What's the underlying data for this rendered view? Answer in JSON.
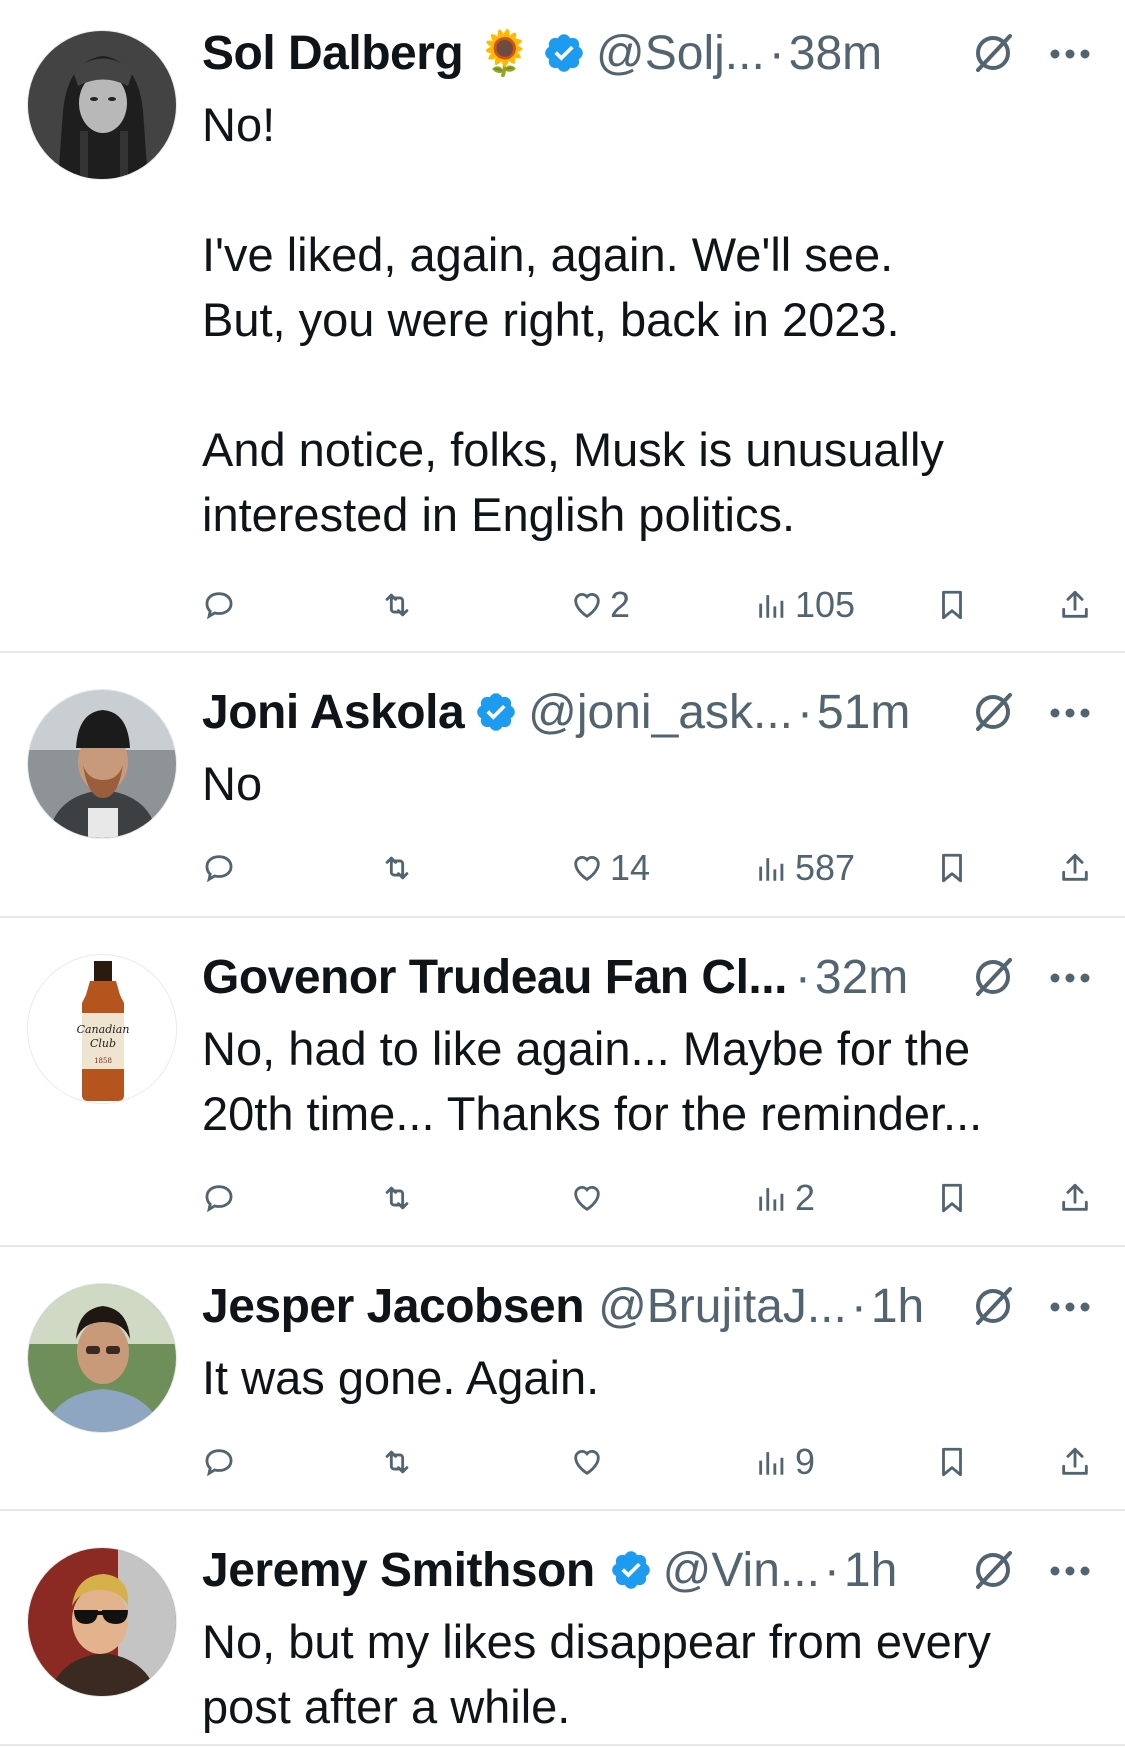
{
  "colors": {
    "verified": "#1d9bf0",
    "muted": "#536471",
    "text": "#0f1419",
    "divider": "#e6e9eb"
  },
  "tweets": [
    {
      "name": "Sol Dalberg",
      "emoji": "🌻",
      "verified": true,
      "handle": "@Solj...",
      "dot": "·",
      "time": "38m",
      "text": "No!\n\nI've liked, again, again. We'll see.\nBut, you were right, back in 2023.\n\nAnd notice, folks, Musk is unusually\ninterested in English politics.",
      "likes": "2",
      "views": "105",
      "avatar_icon": "warrior-portrait"
    },
    {
      "name": "Joni Askola",
      "verified": true,
      "handle": "@joni_ask...",
      "dot": "·",
      "time": "51m",
      "text": "No",
      "likes": "14",
      "views": "587",
      "avatar_icon": "man-beanie-photo"
    },
    {
      "name": "Govenor Trudeau Fan Cl...",
      "verified": false,
      "handle": "",
      "dot": "·",
      "time": "32m",
      "text": "No, had to like again... Maybe for the\n20th time... Thanks for the reminder...",
      "likes": "",
      "views": "2",
      "avatar_icon": "whisky-bottle",
      "avatar_label_1": "Canadian",
      "avatar_label_2": "Club",
      "avatar_label_3": "1858"
    },
    {
      "name": "Jesper Jacobsen",
      "verified": false,
      "handle": "@BrujitaJ...",
      "dot": "·",
      "time": "1h",
      "text": "It was gone. Again.",
      "likes": "",
      "views": "9",
      "avatar_icon": "man-portrait-photo"
    },
    {
      "name": "Jeremy Smithson",
      "verified": true,
      "handle": "@Vin...",
      "dot": "·",
      "time": "1h",
      "text": "No, but my likes disappear from every\npost after a while.",
      "avatar_icon": "man-sunglasses-photo"
    }
  ]
}
